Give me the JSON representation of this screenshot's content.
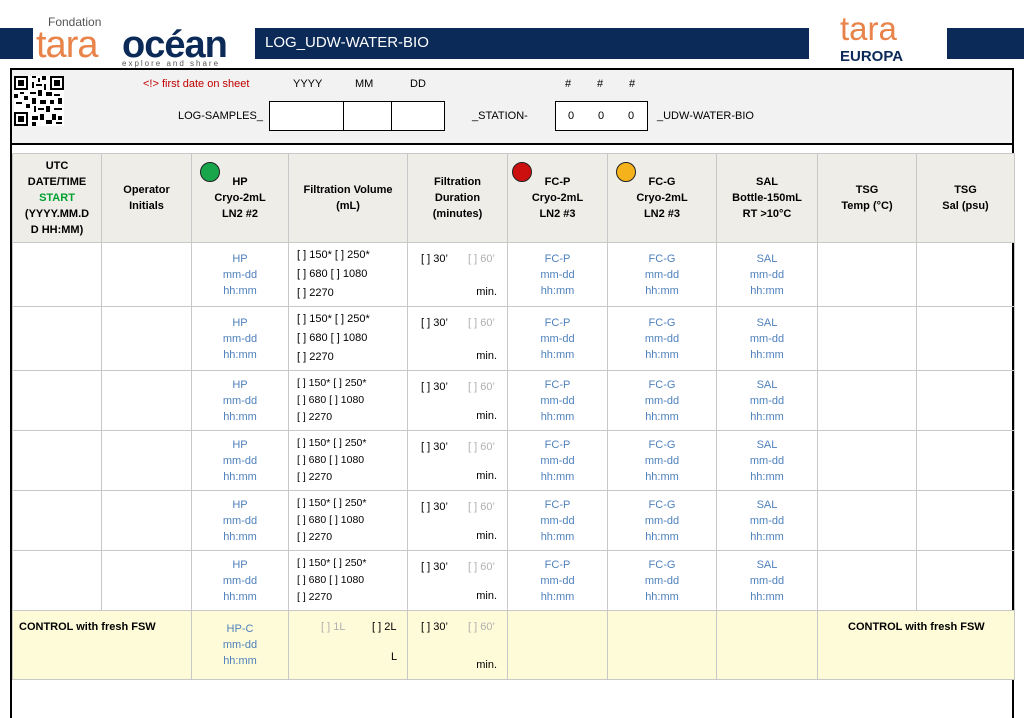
{
  "header": {
    "title": "LOG_UDW-WATER-BIO",
    "logo_left": {
      "fondation": "Fondation",
      "tara": "tara",
      "ocean": "océan",
      "tagline": "explore and share"
    },
    "logo_right": {
      "tara": "tara",
      "europa": "EUROPA"
    }
  },
  "info": {
    "first_date_note": "<!> first date on sheet",
    "yyyy": "YYYY",
    "mm": "MM",
    "dd": "DD",
    "hash1": "#",
    "hash2": "#",
    "hash3": "#",
    "log_samples_label": "LOG-SAMPLES_",
    "station_label": "_STATION-",
    "station_digits": [
      "0",
      "0",
      "0"
    ],
    "suffix": "_UDW-WATER-BIO"
  },
  "columns": {
    "utc": {
      "l1": "UTC",
      "l2": "DATE/TIME",
      "l3": "START",
      "l4": "(YYYY.MM.D",
      "l5": "D   HH:MM)"
    },
    "operator": {
      "l1": "Operator",
      "l2": "Initials"
    },
    "hp": {
      "l1": "HP",
      "l2": "Cryo-2mL",
      "l3": "LN2 #2",
      "dot_color": "#19a64a"
    },
    "filt_vol": {
      "l1": "Filtration Volume",
      "l2": "(mL)"
    },
    "filt_dur": {
      "l1": "Filtration",
      "l2": "Duration",
      "l3": "(minutes)"
    },
    "fcp": {
      "l1": "FC-P",
      "l2": "Cryo-2mL",
      "l3": "LN2 #3",
      "dot_color": "#cc1010"
    },
    "fcg": {
      "l1": "FC-G",
      "l2": "Cryo-2mL",
      "l3": "LN2 #3",
      "dot_color": "#f5b21a"
    },
    "sal": {
      "l1": "SAL",
      "l2": "Bottle-150mL",
      "l3": "RT >10°C"
    },
    "tsg_temp": {
      "l1": "TSG",
      "l2": "Temp (°C)"
    },
    "tsg_sal": {
      "l1": "TSG",
      "l2": "Sal (psu)"
    }
  },
  "row_template": {
    "hp": [
      "HP",
      "mm-dd",
      "hh:mm"
    ],
    "vol": [
      "[ ] 150* [ ] 250*",
      "[ ] 680   [ ] 1080",
      "[ ] 2270"
    ],
    "dur_30": "[ ] 30’",
    "dur_60": "[ ] 60’",
    "dur_min": "min.",
    "fcp": [
      "FC-P",
      "mm-dd",
      "hh:mm"
    ],
    "fcg": [
      "FC-G",
      "mm-dd",
      "hh:mm"
    ],
    "sal": [
      "SAL",
      "mm-dd",
      "hh:mm"
    ]
  },
  "control": {
    "label_left": "CONTROL with fresh FSW",
    "label_right": "CONTROL with fresh FSW",
    "hpc": [
      "HP-C",
      "mm-dd",
      "hh:mm"
    ],
    "vol_1l": "[ ] 1L",
    "vol_2l": "[ ] 2L",
    "vol_l": "L",
    "dur_30": "[ ] 30’",
    "dur_60": "[ ] 60’",
    "dur_min": "min."
  }
}
